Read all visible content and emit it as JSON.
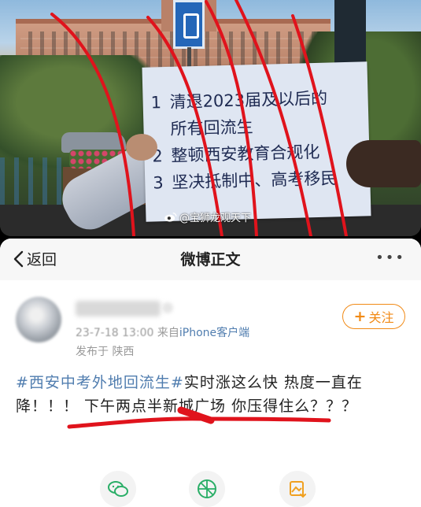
{
  "photo": {
    "sign_lines": [
      {
        "num": "1",
        "text": "清退2023届及以后的"
      },
      {
        "num": "",
        "text": "所有回流生"
      },
      {
        "num": "2",
        "text": "整顿西安教育合规化"
      },
      {
        "num": "3",
        "text": "坚决抵制中、高考移民"
      }
    ],
    "watermark": "@宝狮龙观天下"
  },
  "nav": {
    "back_label": "返回",
    "title": "微博正文",
    "more_label": "•••"
  },
  "post": {
    "date": "23-7-18 13:00",
    "source_prefix": "来自",
    "client": "iPhone客户端",
    "location": "发布于 陕西",
    "follow_label": "关注",
    "hashtag": "#西安中考外地回流生#",
    "text": "实时涨这么快 热度一直在降！！！ 下午两点半新城广场 你压得住么？？？"
  },
  "icons": {
    "back": "chevron-left-icon",
    "share_wechat": "wechat-icon",
    "share_moments": "moments-icon",
    "save_image": "save-image-icon"
  },
  "colors": {
    "hashtag": "#507daf",
    "follow": "#f18a16",
    "scribble": "#e0131c"
  }
}
